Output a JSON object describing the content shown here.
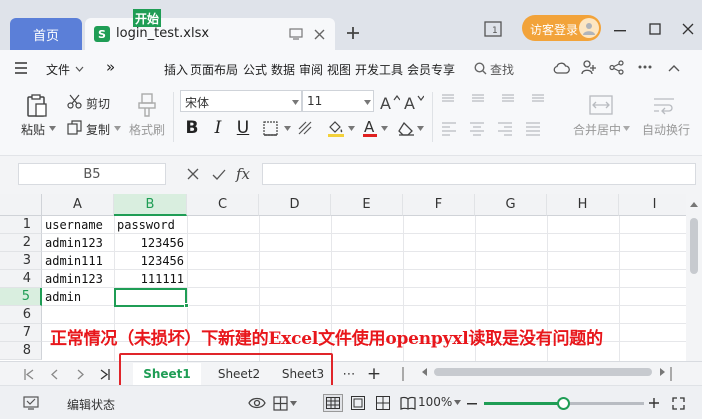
{
  "tabs": {
    "home_label": "首页",
    "file_logo": "S",
    "file_name": "login_test.xlsx",
    "visitor_login": "访客登录"
  },
  "menu": {
    "file_label": "文件",
    "more": "»",
    "items": [
      "开始",
      "插入",
      "页面布局",
      "公式",
      "数据",
      "审阅",
      "视图",
      "开发工具",
      "会员专享"
    ],
    "search_label": "查找"
  },
  "ribbon": {
    "paste": "粘贴",
    "cut": "剪切",
    "copy": "复制",
    "format_painter": "格式刷",
    "font_name": "宋体",
    "font_size": "11",
    "bold": "B",
    "italic": "I",
    "underline": "U",
    "merge_center": "合并居中",
    "auto_wrap": "自动换行"
  },
  "formula_bar": {
    "name_box": "B5",
    "fx": "fx",
    "formula_value": ""
  },
  "grid": {
    "columns": [
      "A",
      "B",
      "C",
      "D",
      "E",
      "F",
      "G",
      "H",
      "I"
    ],
    "rows": [
      "1",
      "2",
      "3",
      "4",
      "5",
      "6",
      "7",
      "8"
    ],
    "cells": {
      "A1": "username",
      "B1": "password",
      "A2": "admin123",
      "B2": "123456",
      "A3": "admin111",
      "B3": "123456",
      "A4": "admin123",
      "B4": "111111",
      "A5": "admin"
    },
    "active_cell": "B5"
  },
  "annotation": "正常情况（未损坏）下新建的Excel文件使用openpyxl读取是没有问题的",
  "sheets": {
    "tabs": [
      "Sheet1",
      "Sheet2",
      "Sheet3"
    ],
    "active": "Sheet1",
    "more": "⋯",
    "add": "+"
  },
  "status": {
    "edit_state": "编辑状态",
    "zoom": "100%",
    "zoom_fraction": 0.5
  },
  "colors": {
    "accent_green": "#1f9d55",
    "home_tab_blue": "#5b7fd8",
    "visitor_orange": "#f2a33a",
    "annotation_red": "#e8161b"
  }
}
